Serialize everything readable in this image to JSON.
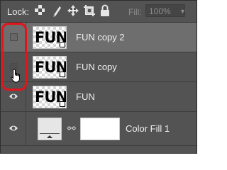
{
  "toolbar": {
    "lock_label": "Lock:",
    "lock_icons": [
      "lock-transparent-pixels-icon",
      "lock-image-pixels-icon",
      "lock-position-icon",
      "lock-artboard-icon",
      "lock-all-icon"
    ],
    "fill_label": "Fill:",
    "fill_value": "100%"
  },
  "layers": [
    {
      "name": "FUN copy 2",
      "thumb_text": "FUN",
      "visible": false,
      "selected": true
    },
    {
      "name": "FUN copy",
      "thumb_text": "FUN",
      "visible": false,
      "selected": false
    },
    {
      "name": "FUN",
      "thumb_text": "FUN",
      "visible": true,
      "selected": false
    }
  ],
  "fill_layer": {
    "name": "Color Fill 1",
    "visible": true,
    "fill_color": "#e6e6e6",
    "mask_color": "#ffffff"
  },
  "colors": {
    "panel": "#535353",
    "selected_row": "#6e6e6e",
    "highlight": "#e4141b"
  }
}
